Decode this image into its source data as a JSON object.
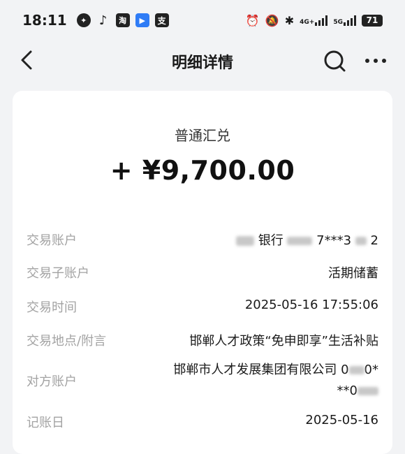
{
  "status_bar": {
    "time": "18:11",
    "apps": [
      "wechat-icon",
      "tiktok-icon",
      "taobao-icon",
      "blue-app-icon",
      "alipay-icon"
    ],
    "net1": "4G+",
    "net2": "5G",
    "battery": "71"
  },
  "nav": {
    "title": "明细详情"
  },
  "transaction": {
    "type": "普通汇兑",
    "amount": "+ ¥9,700.00",
    "rows": [
      {
        "label": "交易账户",
        "value_text": "银行",
        "value_suffix": "7***3",
        "value_end": "2"
      },
      {
        "label": "交易子账户",
        "value": "活期储蓄"
      },
      {
        "label": "交易时间",
        "value": "2025-05-16 17:55:06"
      },
      {
        "label": "交易地点/附言",
        "value": "邯郸人才政策“免申即享”生活补贴"
      },
      {
        "label": "对方账户",
        "value_line1": "邯郸市人才发展集团有限公司 0",
        "value_line1_end": "0*",
        "value_line2": "**0"
      },
      {
        "label": "记账日",
        "value": "2025-05-16"
      }
    ]
  }
}
